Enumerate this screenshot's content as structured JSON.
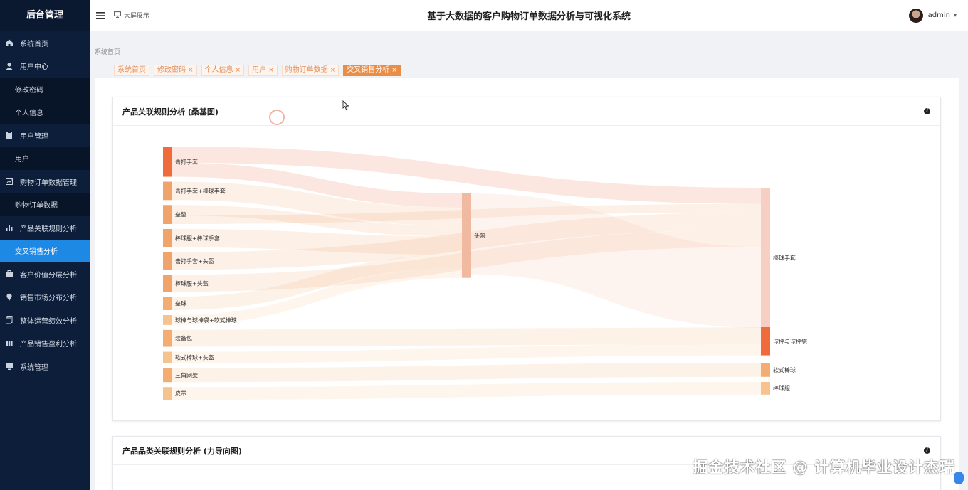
{
  "sidebar": {
    "brand": "后台管理",
    "items": [
      {
        "label": "系统首页",
        "icon": "home-icon",
        "type": "top"
      },
      {
        "label": "用户中心",
        "icon": "user-icon",
        "type": "top"
      },
      {
        "label": "修改密码",
        "type": "sub"
      },
      {
        "label": "个人信息",
        "type": "sub"
      },
      {
        "label": "用户管理",
        "icon": "clipboard-icon",
        "type": "top"
      },
      {
        "label": "用户",
        "type": "sub"
      },
      {
        "label": "购物订单数据管理",
        "icon": "chart-box-icon",
        "type": "top"
      },
      {
        "label": "购物订单数据",
        "type": "sub"
      },
      {
        "label": "产品关联规则分析",
        "icon": "bar-chart-icon",
        "type": "top"
      },
      {
        "label": "交叉销售分析",
        "type": "sub",
        "active": true
      },
      {
        "label": "客户价值分层分析",
        "icon": "briefcase-icon",
        "type": "top"
      },
      {
        "label": "销售市场分布分析",
        "icon": "location-pin-icon",
        "type": "top"
      },
      {
        "label": "整体运营绩效分析",
        "icon": "copy-icon",
        "type": "top"
      },
      {
        "label": "产品销售盈利分析",
        "icon": "columns-icon",
        "type": "top"
      },
      {
        "label": "系统管理",
        "icon": "monitor-icon",
        "type": "top"
      }
    ]
  },
  "header": {
    "big_screen": "大屏展示",
    "title": "基于大数据的客户购物订单数据分析与可视化系统",
    "username": "admin"
  },
  "breadcrumb": "系统首页",
  "tabs": [
    {
      "label": "系统首页",
      "closable": false,
      "active": false
    },
    {
      "label": "修改密码",
      "closable": true,
      "active": false
    },
    {
      "label": "个人信息",
      "closable": true,
      "active": false
    },
    {
      "label": "用户",
      "closable": true,
      "active": false
    },
    {
      "label": "购物订单数据",
      "closable": true,
      "active": false
    },
    {
      "label": "交叉销售分析",
      "closable": true,
      "active": true
    }
  ],
  "close_glyph": "×",
  "cards": {
    "sankey_title": "产品关联规则分析 (桑基图)",
    "force_title": "产品品类关联规则分析 (力导向图)",
    "info_glyph": "i"
  },
  "chart_data": {
    "type": "sankey",
    "title": "产品关联规则分析 (桑基图)",
    "nodes": [
      {
        "name": "击打手套",
        "column": 0,
        "color": "#ef6b3c"
      },
      {
        "name": "击打手套+棒球手套",
        "column": 0,
        "color": "#f1a36c"
      },
      {
        "name": "垒垫",
        "column": 0,
        "color": "#f1a36c"
      },
      {
        "name": "棒球服+棒球手套",
        "column": 0,
        "color": "#f1a36c"
      },
      {
        "name": "击打手套+头盔",
        "column": 0,
        "color": "#f1a36c"
      },
      {
        "name": "棒球服+头盔",
        "column": 0,
        "color": "#f1a36c"
      },
      {
        "name": "垒球",
        "column": 0,
        "color": "#f3ad72"
      },
      {
        "name": "球棒与球棒袋+软式棒球",
        "column": 0,
        "color": "#f6c28e"
      },
      {
        "name": "装备包",
        "column": 0,
        "color": "#f3ad72"
      },
      {
        "name": "软式棒球+头盔",
        "column": 0,
        "color": "#f6c28e"
      },
      {
        "name": "三角网架",
        "column": 0,
        "color": "#f3ad72"
      },
      {
        "name": "皮带",
        "column": 0,
        "color": "#f6c28e"
      },
      {
        "name": "头盔",
        "column": 1,
        "color": "#f2b9a1"
      },
      {
        "name": "棒球手套",
        "column": 2,
        "color": "#f6cfc2"
      },
      {
        "name": "球棒与球棒袋",
        "column": 2,
        "color": "#ef6b3c"
      },
      {
        "name": "软式棒球",
        "column": 2,
        "color": "#f3ad72"
      },
      {
        "name": "棒球服",
        "column": 2,
        "color": "#f6c28e"
      }
    ],
    "links": [
      {
        "source": "击打手套",
        "target": "棒球手套",
        "value": 2.3
      },
      {
        "source": "击打手套",
        "target": "头盔",
        "value": 2.0
      },
      {
        "source": "击打手套+棒球手套",
        "target": "头盔",
        "value": 2.6
      },
      {
        "source": "垒垫",
        "target": "头盔",
        "value": 1.5
      },
      {
        "source": "垒垫",
        "target": "棒球手套",
        "value": 1.2
      },
      {
        "source": "棒球服+棒球手套",
        "target": "头盔",
        "value": 2.6
      },
      {
        "source": "击打手套+头盔",
        "target": "棒球手套",
        "value": 2.5
      },
      {
        "source": "棒球服+头盔",
        "target": "棒球手套",
        "value": 2.4
      },
      {
        "source": "垒球",
        "target": "头盔",
        "value": 1.9
      },
      {
        "source": "球棒与球棒袋+软式棒球",
        "target": "头盔",
        "value": 1.4
      },
      {
        "source": "头盔",
        "target": "棒球手套",
        "value": 11.5
      },
      {
        "source": "装备包",
        "target": "球棒与球棒袋",
        "value": 2.4
      },
      {
        "source": "软式棒球+头盔",
        "target": "球棒与球棒袋",
        "value": 1.6
      },
      {
        "source": "三角网架",
        "target": "软式棒球",
        "value": 2.0
      },
      {
        "source": "皮带",
        "target": "棒球服",
        "value": 1.8
      }
    ]
  },
  "watermark": "掘金技术社区 @ 计算机毕业设计杰瑞"
}
